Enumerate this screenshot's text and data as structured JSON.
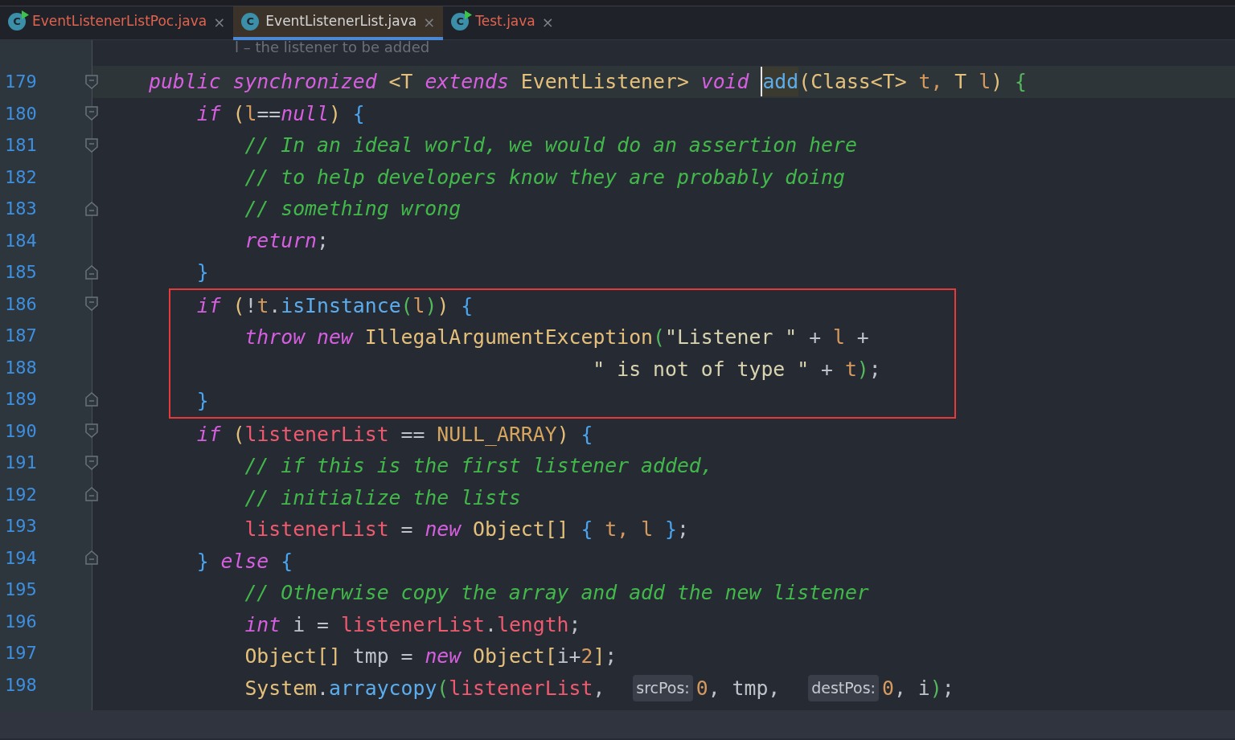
{
  "tabs": [
    {
      "icon": "C",
      "label": "EventListenerListPoc.java",
      "close": "×",
      "selected": false,
      "runnable": true,
      "color": "#e0644f"
    },
    {
      "icon": "C",
      "label": "EventListenerList.java",
      "close": "×",
      "selected": true,
      "runnable": false,
      "color": "#d4d4d4"
    },
    {
      "icon": "C",
      "label": "Test.java",
      "close": "×",
      "selected": false,
      "runnable": true,
      "color": "#e0644f"
    }
  ],
  "doc_hint": "l – the listener to be added",
  "lines": [
    {
      "number": "179",
      "fold_start": true,
      "fold_end": false,
      "current": true,
      "boxed": false,
      "tokens": [
        {
          "text": "public synchronized ",
          "kind": "keyword"
        },
        {
          "text": "<",
          "kind": "type"
        },
        {
          "text": "T ",
          "kind": "type"
        },
        {
          "text": "extends ",
          "kind": "keyword"
        },
        {
          "text": "EventListener> ",
          "kind": "type"
        },
        {
          "text": "void ",
          "kind": "keyword"
        },
        {
          "text": "add",
          "kind": "method",
          "at_caret": true
        },
        {
          "text": "(",
          "kind": "bracket1"
        },
        {
          "text": "Class<T> ",
          "kind": "type"
        },
        {
          "text": "t, ",
          "kind": "param"
        },
        {
          "text": "T ",
          "kind": "type"
        },
        {
          "text": "l",
          "kind": "param"
        },
        {
          "text": ") ",
          "kind": "bracket1"
        },
        {
          "text": "{",
          "kind": "bracket3"
        }
      ]
    },
    {
      "number": "180",
      "fold_start": true,
      "fold_end": false,
      "current": false,
      "boxed": false,
      "tokens": [
        {
          "text": "    if ",
          "kind": "keyword"
        },
        {
          "text": "(",
          "kind": "bracket1"
        },
        {
          "text": "l",
          "kind": "param"
        },
        {
          "text": "==",
          "kind": "plain"
        },
        {
          "text": "null",
          "kind": "keyword"
        },
        {
          "text": ") ",
          "kind": "bracket1"
        },
        {
          "text": "{",
          "kind": "bracket2"
        }
      ]
    },
    {
      "number": "181",
      "fold_start": true,
      "fold_end": false,
      "current": false,
      "boxed": false,
      "tokens": [
        {
          "text": "        // In an ideal world, we would do an assertion here",
          "kind": "comment"
        }
      ]
    },
    {
      "number": "182",
      "fold_start": false,
      "fold_end": false,
      "current": false,
      "boxed": false,
      "tokens": [
        {
          "text": "        // to help developers know they are probably doing",
          "kind": "comment"
        }
      ]
    },
    {
      "number": "183",
      "fold_start": false,
      "fold_end": true,
      "current": false,
      "boxed": false,
      "tokens": [
        {
          "text": "        // something wrong",
          "kind": "comment"
        }
      ]
    },
    {
      "number": "184",
      "fold_start": false,
      "fold_end": false,
      "current": false,
      "boxed": false,
      "tokens": [
        {
          "text": "        return",
          "kind": "keyword"
        },
        {
          "text": ";",
          "kind": "plain"
        }
      ]
    },
    {
      "number": "185",
      "fold_start": false,
      "fold_end": true,
      "current": false,
      "boxed": false,
      "tokens": [
        {
          "text": "    }",
          "kind": "bracket2"
        }
      ]
    },
    {
      "number": "186",
      "fold_start": true,
      "fold_end": false,
      "current": false,
      "boxed": true,
      "tokens": [
        {
          "text": "    if ",
          "kind": "keyword"
        },
        {
          "text": "(",
          "kind": "bracket1"
        },
        {
          "text": "!",
          "kind": "plain"
        },
        {
          "text": "t",
          "kind": "param"
        },
        {
          "text": ".",
          "kind": "plain"
        },
        {
          "text": "isInstance",
          "kind": "method"
        },
        {
          "text": "(",
          "kind": "bracket3"
        },
        {
          "text": "l",
          "kind": "param"
        },
        {
          "text": ")",
          "kind": "bracket3"
        },
        {
          "text": ") ",
          "kind": "bracket1"
        },
        {
          "text": "{",
          "kind": "bracket2"
        }
      ]
    },
    {
      "number": "187",
      "fold_start": false,
      "fold_end": false,
      "current": false,
      "boxed": true,
      "tokens": [
        {
          "text": "        throw new ",
          "kind": "keyword"
        },
        {
          "text": "IllegalArgumentException",
          "kind": "type"
        },
        {
          "text": "(",
          "kind": "bracket3"
        },
        {
          "text": "\"Listener \"",
          "kind": "string"
        },
        {
          "text": " + ",
          "kind": "plain"
        },
        {
          "text": "l",
          "kind": "param"
        },
        {
          "text": " +",
          "kind": "plain"
        }
      ]
    },
    {
      "number": "188",
      "fold_start": false,
      "fold_end": false,
      "current": false,
      "boxed": true,
      "tokens": [
        {
          "text": "                                     \" is not of type \"",
          "kind": "string"
        },
        {
          "text": " + ",
          "kind": "plain"
        },
        {
          "text": "t",
          "kind": "param"
        },
        {
          "text": ")",
          "kind": "bracket3"
        },
        {
          "text": ";",
          "kind": "plain"
        }
      ]
    },
    {
      "number": "189",
      "fold_start": false,
      "fold_end": true,
      "current": false,
      "boxed": true,
      "tokens": [
        {
          "text": "    }",
          "kind": "bracket2"
        }
      ]
    },
    {
      "number": "190",
      "fold_start": true,
      "fold_end": false,
      "current": false,
      "boxed": false,
      "tokens": [
        {
          "text": "    if ",
          "kind": "keyword"
        },
        {
          "text": "(",
          "kind": "bracket1"
        },
        {
          "text": "listenerList",
          "kind": "field"
        },
        {
          "text": " == ",
          "kind": "plain"
        },
        {
          "text": "NULL_ARRAY",
          "kind": "constant"
        },
        {
          "text": ") ",
          "kind": "bracket1"
        },
        {
          "text": "{",
          "kind": "bracket2"
        }
      ]
    },
    {
      "number": "191",
      "fold_start": true,
      "fold_end": false,
      "current": false,
      "boxed": false,
      "tokens": [
        {
          "text": "        // if this is the first listener added,",
          "kind": "comment"
        }
      ]
    },
    {
      "number": "192",
      "fold_start": false,
      "fold_end": true,
      "current": false,
      "boxed": false,
      "tokens": [
        {
          "text": "        // initialize the lists",
          "kind": "comment"
        }
      ]
    },
    {
      "number": "193",
      "fold_start": false,
      "fold_end": false,
      "current": false,
      "boxed": false,
      "tokens": [
        {
          "text": "        listenerList",
          "kind": "field"
        },
        {
          "text": " = ",
          "kind": "plain"
        },
        {
          "text": "new ",
          "kind": "keyword"
        },
        {
          "text": "Object",
          "kind": "type"
        },
        {
          "text": "[] ",
          "kind": "bracket1"
        },
        {
          "text": "{ ",
          "kind": "bracket2"
        },
        {
          "text": "t, ",
          "kind": "param"
        },
        {
          "text": "l ",
          "kind": "param"
        },
        {
          "text": "}",
          "kind": "bracket2"
        },
        {
          "text": ";",
          "kind": "plain"
        }
      ]
    },
    {
      "number": "194",
      "fold_start": false,
      "fold_end": true,
      "current": false,
      "boxed": false,
      "tokens": [
        {
          "text": "    } ",
          "kind": "bracket2"
        },
        {
          "text": "else ",
          "kind": "keyword"
        },
        {
          "text": "{",
          "kind": "bracket2"
        }
      ]
    },
    {
      "number": "195",
      "fold_start": false,
      "fold_end": false,
      "current": false,
      "boxed": false,
      "tokens": [
        {
          "text": "        // Otherwise copy the array and add the new listener",
          "kind": "comment"
        }
      ]
    },
    {
      "number": "196",
      "fold_start": false,
      "fold_end": false,
      "current": false,
      "boxed": false,
      "tokens": [
        {
          "text": "        int ",
          "kind": "keyword"
        },
        {
          "text": "i = ",
          "kind": "plain"
        },
        {
          "text": "listenerList",
          "kind": "field"
        },
        {
          "text": ".",
          "kind": "plain"
        },
        {
          "text": "length",
          "kind": "field"
        },
        {
          "text": ";",
          "kind": "plain"
        }
      ]
    },
    {
      "number": "197",
      "fold_start": false,
      "fold_end": false,
      "current": false,
      "boxed": false,
      "tokens": [
        {
          "text": "        Object",
          "kind": "type"
        },
        {
          "text": "[] ",
          "kind": "bracket1"
        },
        {
          "text": "tmp = ",
          "kind": "plain"
        },
        {
          "text": "new ",
          "kind": "keyword"
        },
        {
          "text": "Object",
          "kind": "type"
        },
        {
          "text": "[",
          "kind": "bracket1"
        },
        {
          "text": "i+",
          "kind": "plain"
        },
        {
          "text": "2",
          "kind": "number"
        },
        {
          "text": "]",
          "kind": "bracket1"
        },
        {
          "text": ";",
          "kind": "plain"
        }
      ]
    },
    {
      "number": "198",
      "fold_start": false,
      "fold_end": false,
      "current": false,
      "boxed": false,
      "tokens": [
        {
          "text": "        System",
          "kind": "type"
        },
        {
          "text": ".",
          "kind": "plain"
        },
        {
          "text": "arraycopy",
          "kind": "method"
        },
        {
          "text": "(",
          "kind": "bracket3"
        },
        {
          "text": "listenerList",
          "kind": "field"
        },
        {
          "text": ", ",
          "kind": "plain"
        },
        {
          "text": "srcPos:",
          "kind": "hint"
        },
        {
          "text": "0",
          "kind": "number"
        },
        {
          "text": ", tmp, ",
          "kind": "plain"
        },
        {
          "text": "destPos:",
          "kind": "hint"
        },
        {
          "text": "0",
          "kind": "number"
        },
        {
          "text": ", i",
          "kind": "plain"
        },
        {
          "text": ")",
          "kind": "bracket3"
        },
        {
          "text": ";",
          "kind": "plain"
        }
      ]
    }
  ]
}
